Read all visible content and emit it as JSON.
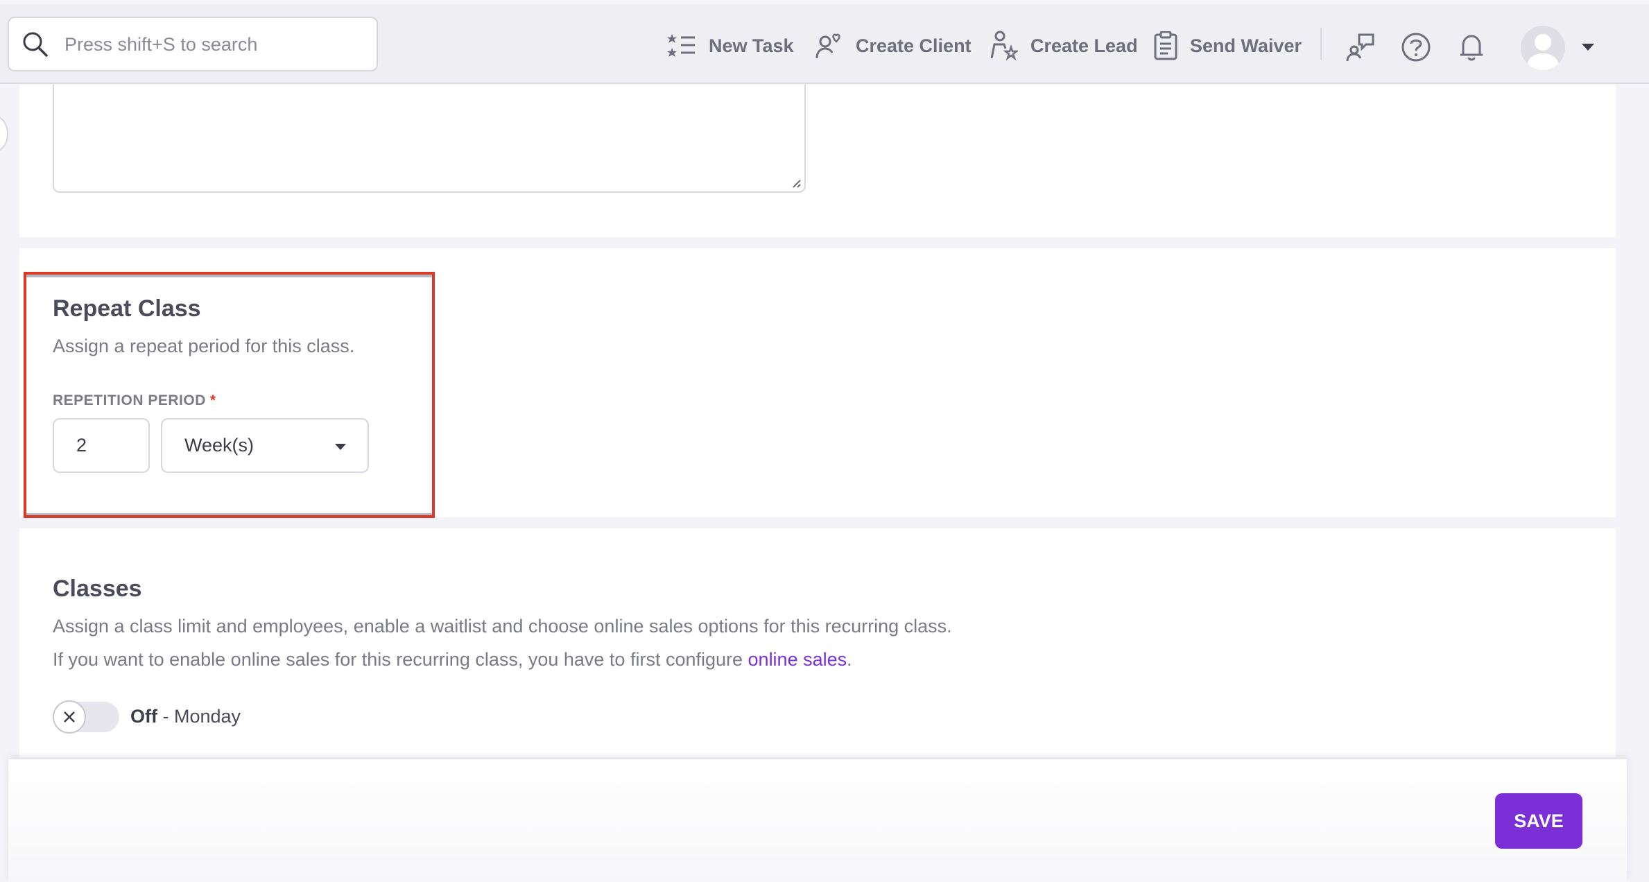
{
  "search": {
    "placeholder": "Press shift+S to search"
  },
  "header": {
    "actions": [
      {
        "label": "New Task",
        "icon": "task-list-icon"
      },
      {
        "label": "Create Client",
        "icon": "client-heart-icon"
      },
      {
        "label": "Create Lead",
        "icon": "lead-star-icon"
      },
      {
        "label": "Send Waiver",
        "icon": "clipboard-icon"
      }
    ],
    "icons": [
      "chat-user-icon",
      "help-icon",
      "bell-icon",
      "avatar",
      "chevron-down-icon"
    ]
  },
  "repeat_class": {
    "title": "Repeat Class",
    "description": "Assign a repeat period for this class.",
    "field_label": "REPETITION PERIOD",
    "required_mark": "*",
    "period_value": "2",
    "period_unit": "Week(s)"
  },
  "classes": {
    "title": "Classes",
    "description": "Assign a class limit and employees, enable a waitlist and choose online sales options for this recurring class.",
    "online_sales_prefix": "If you want to enable online sales for this recurring class, you have to first configure ",
    "online_sales_link": "online sales",
    "online_sales_suffix": ".",
    "toggle_state": "Off",
    "toggle_day": " - Monday"
  },
  "footer": {
    "save_label": "SAVE"
  },
  "colors": {
    "accent": "#7b2fd6",
    "highlight": "#d93a2a"
  }
}
